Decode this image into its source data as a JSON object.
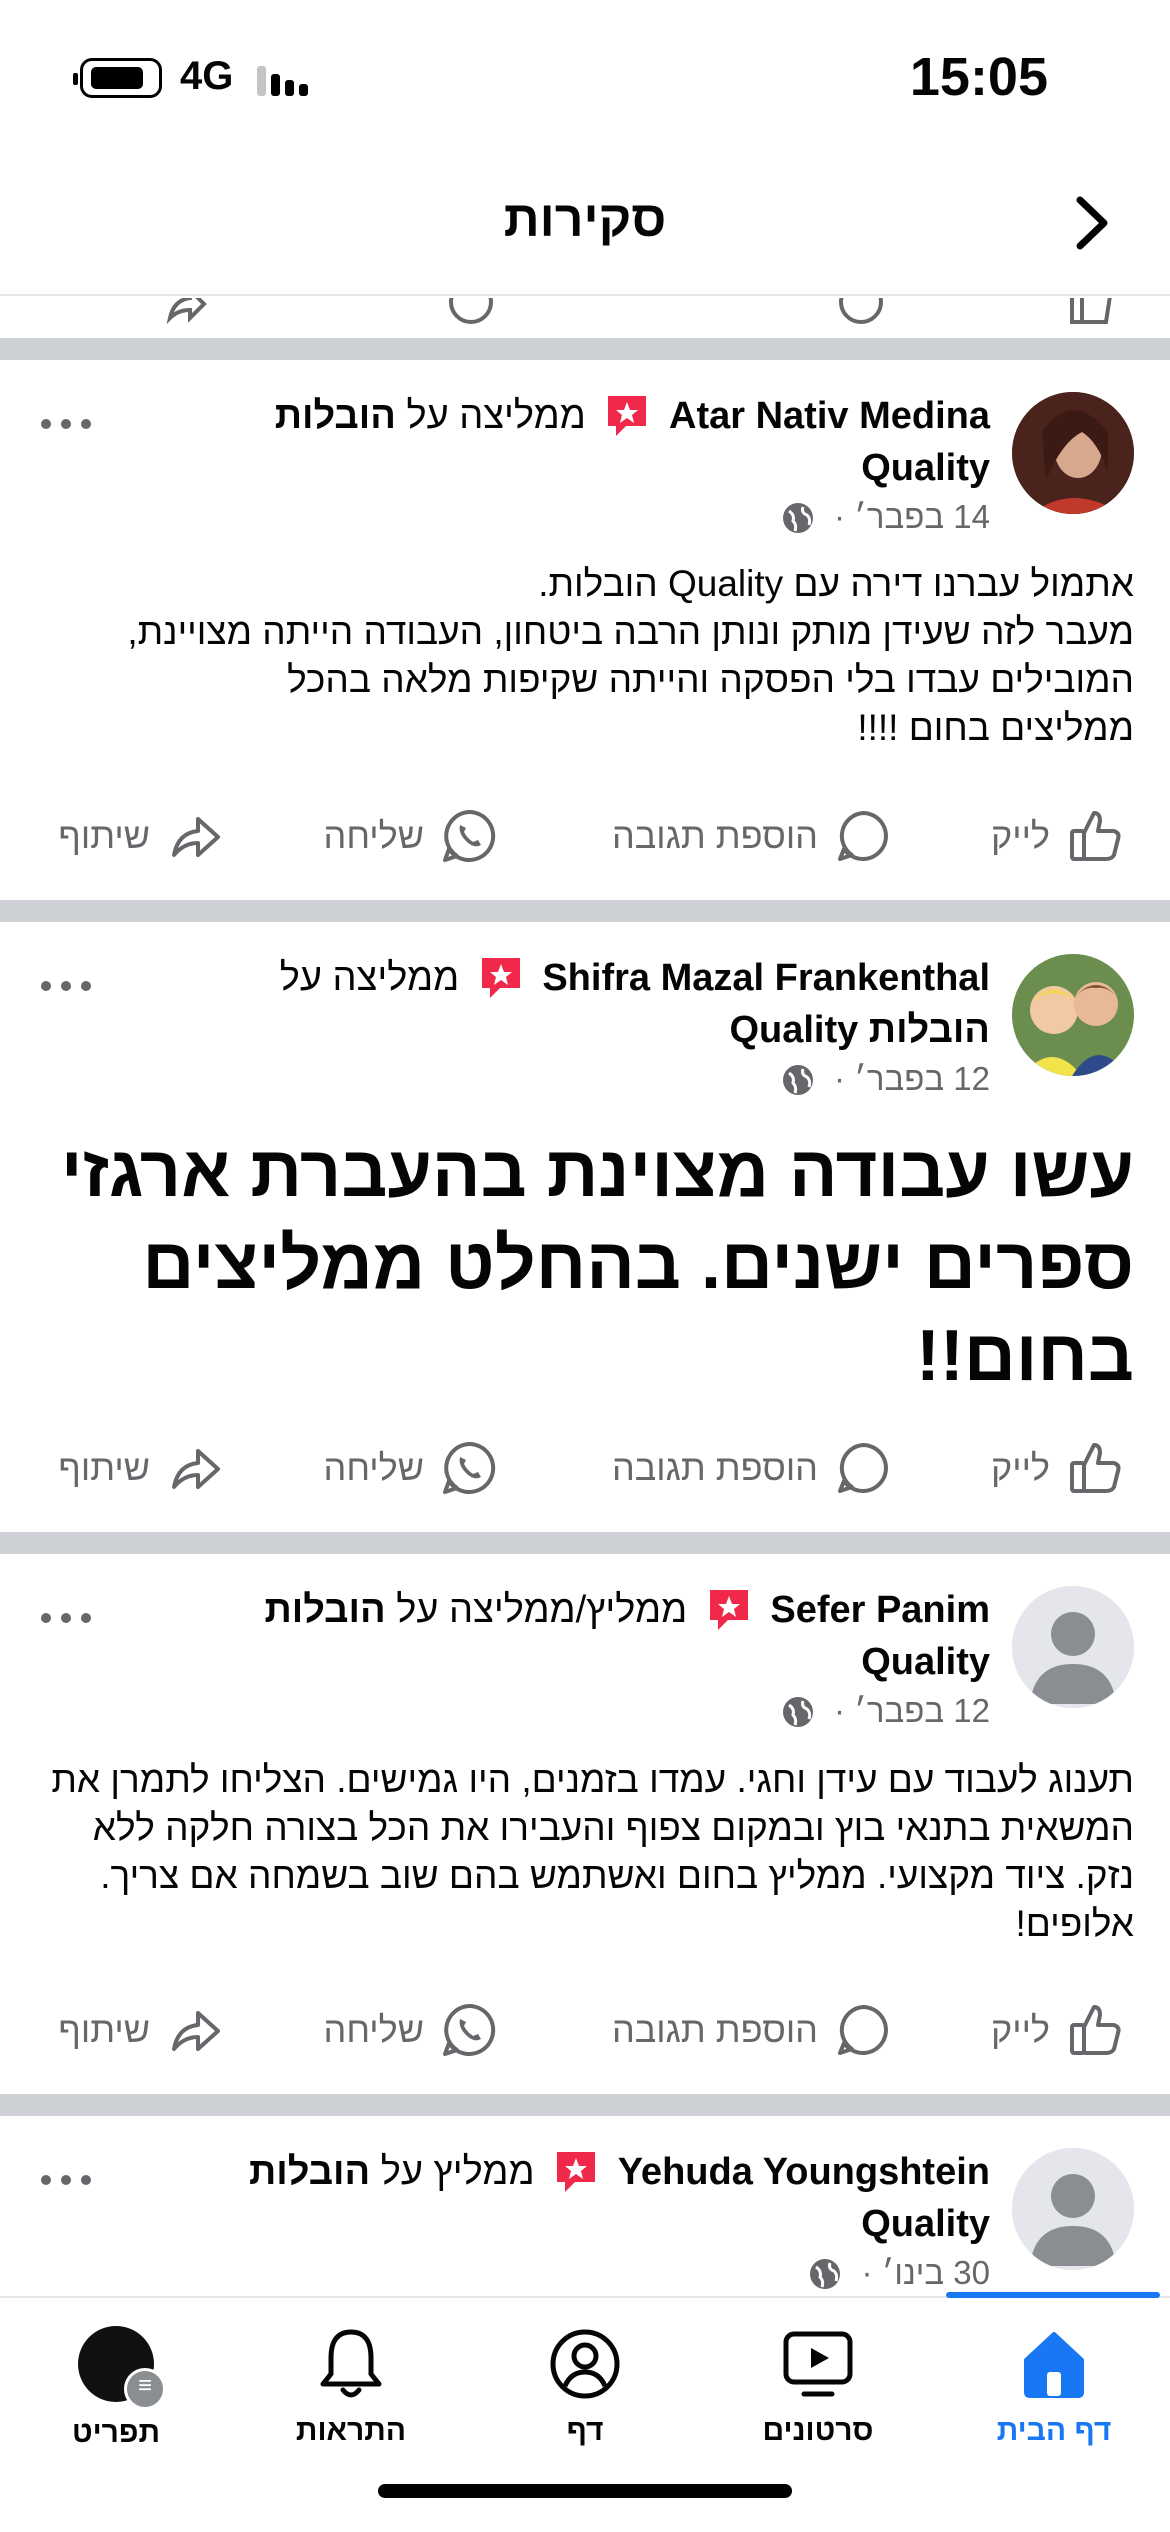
{
  "status_bar": {
    "network": "4G",
    "time": "15:05"
  },
  "header": {
    "title": "סקירות"
  },
  "posts": [
    {
      "author": "Atar Nativ Medina",
      "verb": "ממליצה על",
      "page_name": "הובלות Quality",
      "date": "14 בפבר׳ ·",
      "text": "אתמול עברנו דירה עם Quality   הובלות.\nמעבר לזה שעידן מותק ונותן הרבה ביטחון, העבודה הייתה מצויינת, המובילים עבדו בלי הפסקה והייתה שקיפות מלאה בהכל\nממליצים בחום !!!!"
    },
    {
      "author": "Shifra Mazal Frankenthal",
      "verb": "ממליצה על",
      "page_name": "הובלות Quality",
      "date": "12 בפבר׳ ·",
      "text": "עשו עבודה מצוינת בהעברת ארגזי ספרים ישנים. בהחלט ממליצים בחום!!"
    },
    {
      "author": "Sefer Panim",
      "verb": "ממליץ/ממליצה על",
      "page_name": "הובלות Quality",
      "date": "12 בפבר׳ ·",
      "text": "תענוג לעבוד עם עידן וחגי. עמדו בזמנים, היו גמישים. הצליחו לתמרן את המשאית בתנאי בוץ ובמקום צפוף והעבירו את הכל בצורה חלקה ללא נזק. ציוד מקצועי. ממליץ בחום ואשתמש בהם שוב בשמחה אם צריך. אלופים!"
    },
    {
      "author": "Yehuda Youngshtein",
      "verb": "ממליץ על",
      "page_name": "הובלות Quality",
      "date": "30 בינו׳ ·",
      "text": ""
    }
  ],
  "actions": {
    "like": "לייק",
    "comment": "הוספת תגובה",
    "send": "שליחה",
    "share": "שיתוף"
  },
  "tabs": [
    {
      "label": "דף הבית",
      "icon": "home-icon",
      "active": true
    },
    {
      "label": "סרטונים",
      "icon": "video-icon",
      "active": false
    },
    {
      "label": "דף",
      "icon": "page-icon",
      "active": false
    },
    {
      "label": "התראות",
      "icon": "bell-icon",
      "active": false
    },
    {
      "label": "תפריט",
      "icon": "menu-profile-icon",
      "active": false
    }
  ],
  "colors": {
    "accent": "#1877f2",
    "secondary_text": "#65676b",
    "recommend_badge": "#f02849",
    "separator": "#ccd0d5"
  }
}
